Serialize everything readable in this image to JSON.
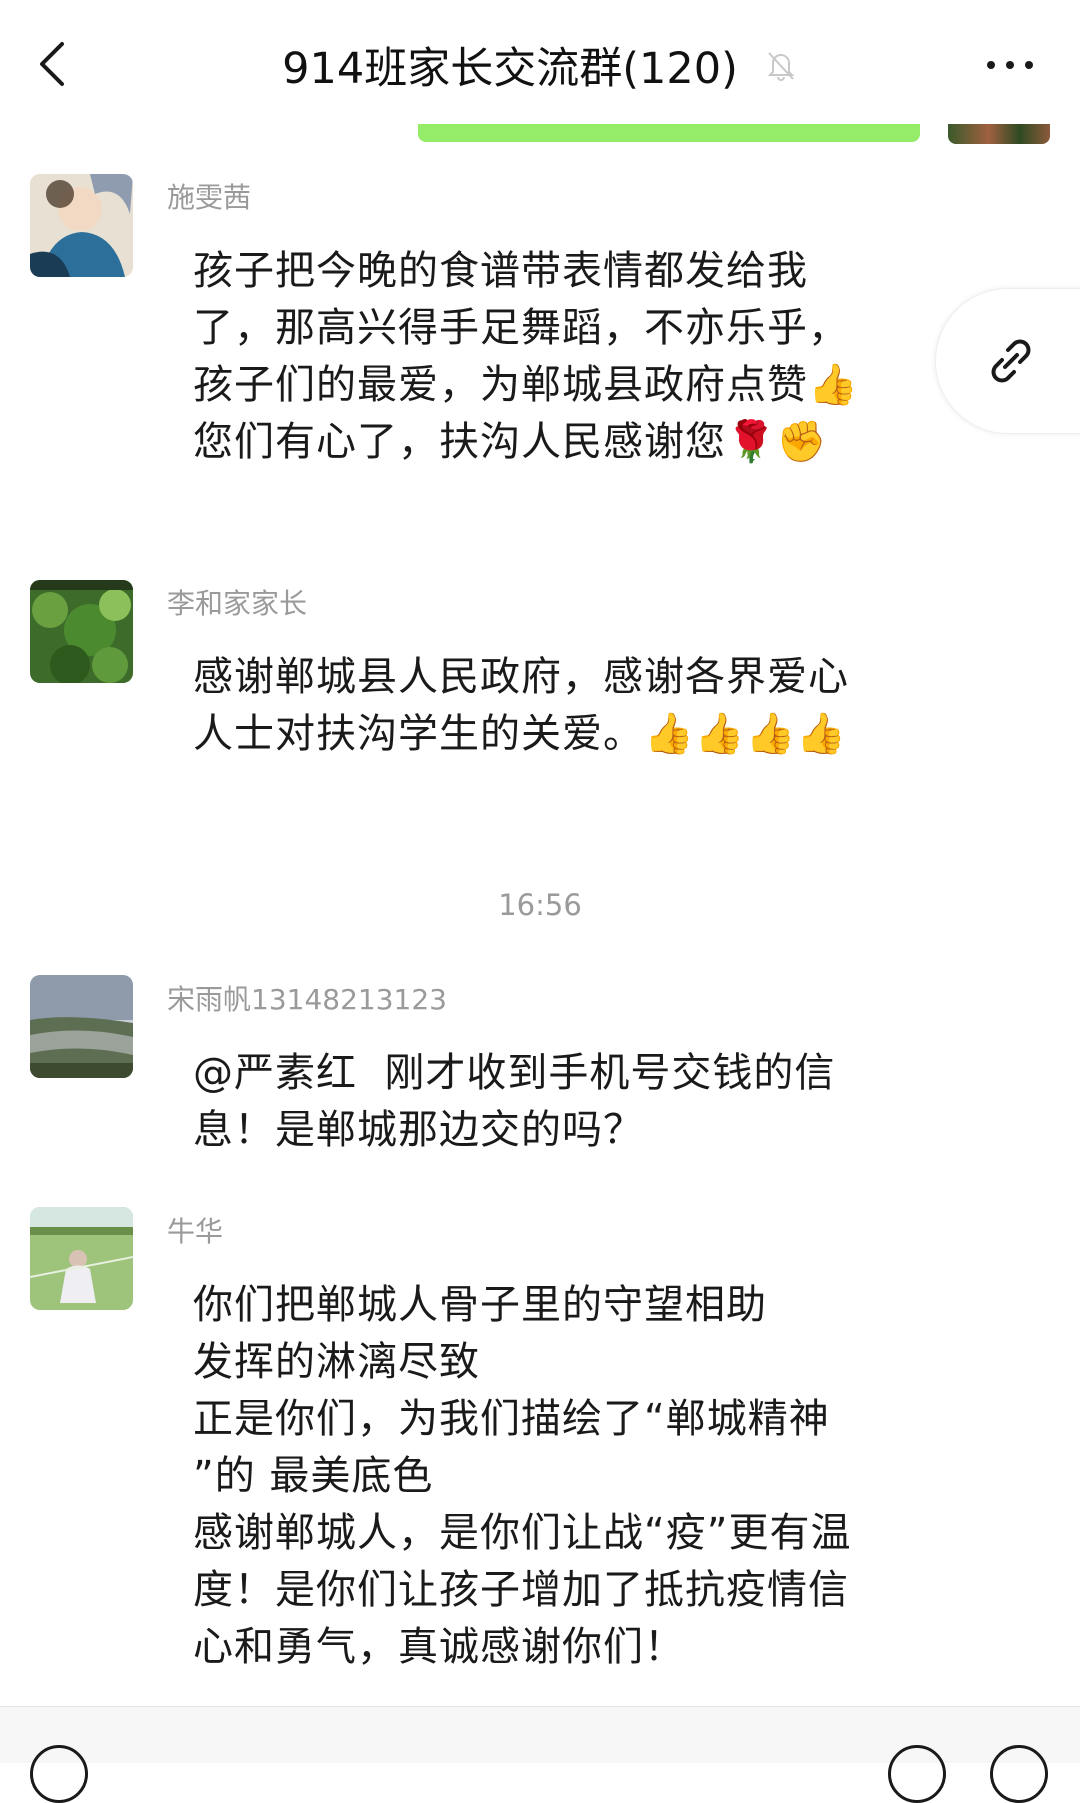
{
  "header": {
    "title": "914班家长交流群(120)",
    "back_icon": "chevron-left-icon",
    "mute_icon": "bell-off-icon",
    "more_icon": "more-horizontal-icon"
  },
  "float_button": {
    "icon": "link-icon"
  },
  "messages": [
    {
      "sender": "施雯茜",
      "text": "孩子把今晚的食谱带表情都发给我了，那高兴得手足舞蹈，不亦乐乎，孩子们的最爱，为郸城县政府点赞👍您们有心了，扶沟人民感谢您🌹✊"
    },
    {
      "sender": "李和家家长",
      "text": "感谢郸城县人民政府，感谢各界爱心人士对扶沟学生的关爱。👍👍👍👍"
    },
    {
      "sender": "宋雨帆13148213123",
      "text": "@严素红  刚才收到手机号交钱的信息！是郸城那边交的吗？"
    },
    {
      "sender": "牛华",
      "text": "你们把郸城人骨子里的守望相助\n发挥的淋漓尽致\n正是你们，为我们描绘了“郸城精神\n”的 最美底色\n感谢郸城人，是你们让战“疫”更有温度！是你们让孩子增加了抵抗疫情信心和勇气，真诚感谢你们！"
    }
  ],
  "timestamp": "16:56",
  "colors": {
    "accent_bubble": "#95ec69",
    "sender_name": "#9a9a9a",
    "background": "#ffffff"
  }
}
